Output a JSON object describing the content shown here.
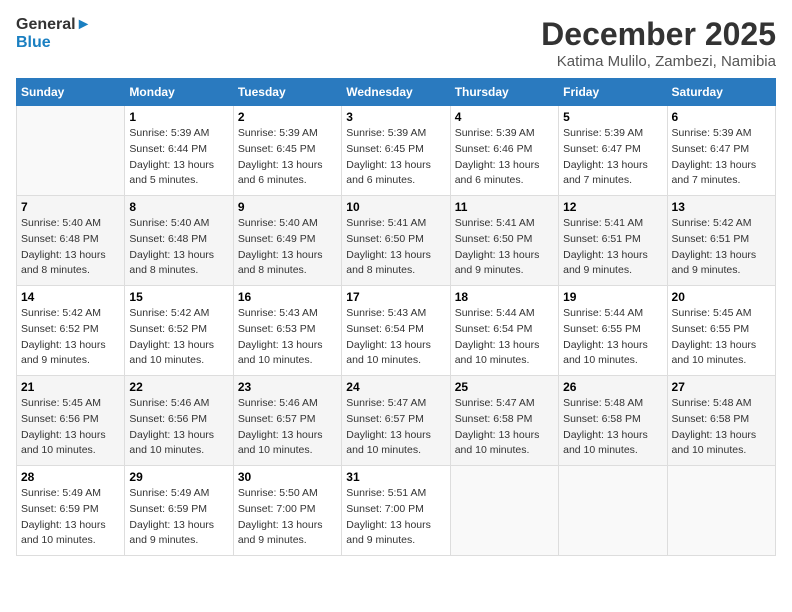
{
  "header": {
    "logo_line1": "General",
    "logo_line2": "Blue",
    "month": "December 2025",
    "location": "Katima Mulilo, Zambezi, Namibia"
  },
  "days_of_week": [
    "Sunday",
    "Monday",
    "Tuesday",
    "Wednesday",
    "Thursday",
    "Friday",
    "Saturday"
  ],
  "weeks": [
    [
      {
        "day": "",
        "info": ""
      },
      {
        "day": "1",
        "info": "Sunrise: 5:39 AM\nSunset: 6:44 PM\nDaylight: 13 hours\nand 5 minutes."
      },
      {
        "day": "2",
        "info": "Sunrise: 5:39 AM\nSunset: 6:45 PM\nDaylight: 13 hours\nand 6 minutes."
      },
      {
        "day": "3",
        "info": "Sunrise: 5:39 AM\nSunset: 6:45 PM\nDaylight: 13 hours\nand 6 minutes."
      },
      {
        "day": "4",
        "info": "Sunrise: 5:39 AM\nSunset: 6:46 PM\nDaylight: 13 hours\nand 6 minutes."
      },
      {
        "day": "5",
        "info": "Sunrise: 5:39 AM\nSunset: 6:47 PM\nDaylight: 13 hours\nand 7 minutes."
      },
      {
        "day": "6",
        "info": "Sunrise: 5:39 AM\nSunset: 6:47 PM\nDaylight: 13 hours\nand 7 minutes."
      }
    ],
    [
      {
        "day": "7",
        "info": "Sunrise: 5:40 AM\nSunset: 6:48 PM\nDaylight: 13 hours\nand 8 minutes."
      },
      {
        "day": "8",
        "info": "Sunrise: 5:40 AM\nSunset: 6:48 PM\nDaylight: 13 hours\nand 8 minutes."
      },
      {
        "day": "9",
        "info": "Sunrise: 5:40 AM\nSunset: 6:49 PM\nDaylight: 13 hours\nand 8 minutes."
      },
      {
        "day": "10",
        "info": "Sunrise: 5:41 AM\nSunset: 6:50 PM\nDaylight: 13 hours\nand 8 minutes."
      },
      {
        "day": "11",
        "info": "Sunrise: 5:41 AM\nSunset: 6:50 PM\nDaylight: 13 hours\nand 9 minutes."
      },
      {
        "day": "12",
        "info": "Sunrise: 5:41 AM\nSunset: 6:51 PM\nDaylight: 13 hours\nand 9 minutes."
      },
      {
        "day": "13",
        "info": "Sunrise: 5:42 AM\nSunset: 6:51 PM\nDaylight: 13 hours\nand 9 minutes."
      }
    ],
    [
      {
        "day": "14",
        "info": "Sunrise: 5:42 AM\nSunset: 6:52 PM\nDaylight: 13 hours\nand 9 minutes."
      },
      {
        "day": "15",
        "info": "Sunrise: 5:42 AM\nSunset: 6:52 PM\nDaylight: 13 hours\nand 10 minutes."
      },
      {
        "day": "16",
        "info": "Sunrise: 5:43 AM\nSunset: 6:53 PM\nDaylight: 13 hours\nand 10 minutes."
      },
      {
        "day": "17",
        "info": "Sunrise: 5:43 AM\nSunset: 6:54 PM\nDaylight: 13 hours\nand 10 minutes."
      },
      {
        "day": "18",
        "info": "Sunrise: 5:44 AM\nSunset: 6:54 PM\nDaylight: 13 hours\nand 10 minutes."
      },
      {
        "day": "19",
        "info": "Sunrise: 5:44 AM\nSunset: 6:55 PM\nDaylight: 13 hours\nand 10 minutes."
      },
      {
        "day": "20",
        "info": "Sunrise: 5:45 AM\nSunset: 6:55 PM\nDaylight: 13 hours\nand 10 minutes."
      }
    ],
    [
      {
        "day": "21",
        "info": "Sunrise: 5:45 AM\nSunset: 6:56 PM\nDaylight: 13 hours\nand 10 minutes."
      },
      {
        "day": "22",
        "info": "Sunrise: 5:46 AM\nSunset: 6:56 PM\nDaylight: 13 hours\nand 10 minutes."
      },
      {
        "day": "23",
        "info": "Sunrise: 5:46 AM\nSunset: 6:57 PM\nDaylight: 13 hours\nand 10 minutes."
      },
      {
        "day": "24",
        "info": "Sunrise: 5:47 AM\nSunset: 6:57 PM\nDaylight: 13 hours\nand 10 minutes."
      },
      {
        "day": "25",
        "info": "Sunrise: 5:47 AM\nSunset: 6:58 PM\nDaylight: 13 hours\nand 10 minutes."
      },
      {
        "day": "26",
        "info": "Sunrise: 5:48 AM\nSunset: 6:58 PM\nDaylight: 13 hours\nand 10 minutes."
      },
      {
        "day": "27",
        "info": "Sunrise: 5:48 AM\nSunset: 6:58 PM\nDaylight: 13 hours\nand 10 minutes."
      }
    ],
    [
      {
        "day": "28",
        "info": "Sunrise: 5:49 AM\nSunset: 6:59 PM\nDaylight: 13 hours\nand 10 minutes."
      },
      {
        "day": "29",
        "info": "Sunrise: 5:49 AM\nSunset: 6:59 PM\nDaylight: 13 hours\nand 9 minutes."
      },
      {
        "day": "30",
        "info": "Sunrise: 5:50 AM\nSunset: 7:00 PM\nDaylight: 13 hours\nand 9 minutes."
      },
      {
        "day": "31",
        "info": "Sunrise: 5:51 AM\nSunset: 7:00 PM\nDaylight: 13 hours\nand 9 minutes."
      },
      {
        "day": "",
        "info": ""
      },
      {
        "day": "",
        "info": ""
      },
      {
        "day": "",
        "info": ""
      }
    ]
  ]
}
